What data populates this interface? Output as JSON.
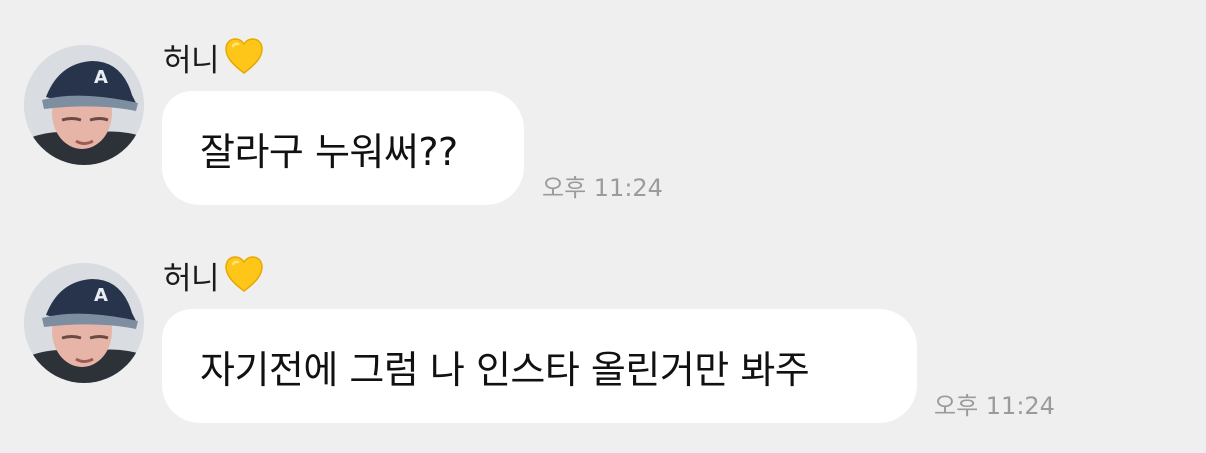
{
  "messages": [
    {
      "sender": "허니",
      "text": "잘라구 누워써??",
      "time": "오후 11:24"
    },
    {
      "sender": "허니",
      "text": "자기전에 그럼 나 인스타 올린거만 봐주",
      "time": "오후 11:24"
    }
  ],
  "icons": {
    "heart": "yellow-heart-icon",
    "avatar": "profile-photo"
  },
  "colors": {
    "background": "#efefef",
    "bubble": "#ffffff",
    "timestamp": "#9b9b9b",
    "heart": "#ffc61a"
  }
}
